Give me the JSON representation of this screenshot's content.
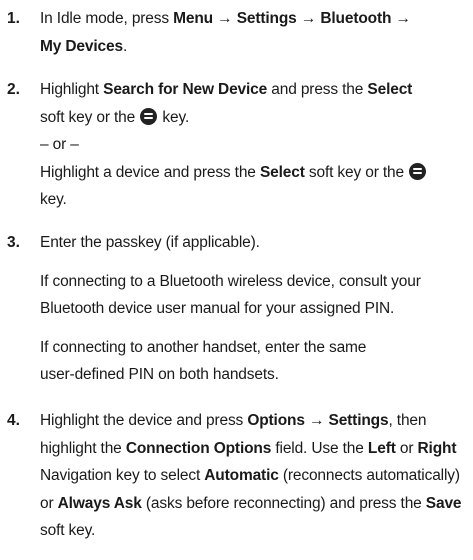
{
  "arrow": "→",
  "steps": [
    {
      "number": "1.",
      "t1": "In Idle mode, press ",
      "menu": "Menu",
      "settings": "Settings",
      "bluetooth": "Bluetooth",
      "my_devices": "My Devices",
      "period": "."
    },
    {
      "number": "2.",
      "t1": "Highlight ",
      "search_new": "Search for New Device",
      "t2": " and press the ",
      "select": "Select",
      "t3": " soft key or the ",
      "t4": " key.",
      "or": "– or –",
      "t5": "Highlight a device and press the ",
      "t6": " soft key or the ",
      "t7": "key."
    },
    {
      "number": "3.",
      "p1": "Enter the passkey (if applicable).",
      "p2": "If connecting to a Bluetooth wireless device, consult your Bluetooth device user manual for your assigned PIN.",
      "p3": "If connecting to another handset, enter the same user-defined PIN on both handsets."
    },
    {
      "number": "4.",
      "t1": "Highlight the device and press ",
      "options": "Options",
      "settings": "Settings",
      "t2": ", then highlight the ",
      "connection_options": "Connection Options",
      "t3": " field. Use the ",
      "left": "Left",
      "t4": " or ",
      "right": "Right",
      "t5": " Navigation key to select ",
      "automatic": "Automatic",
      "t6": " (reconnects automatically) or ",
      "always_ask": "Always Ask",
      "t7": " (asks before reconnecting) and press the ",
      "save": "Save",
      "t8": " soft key."
    }
  ],
  "icons": {
    "select_key": "menu-ok-key-icon"
  }
}
